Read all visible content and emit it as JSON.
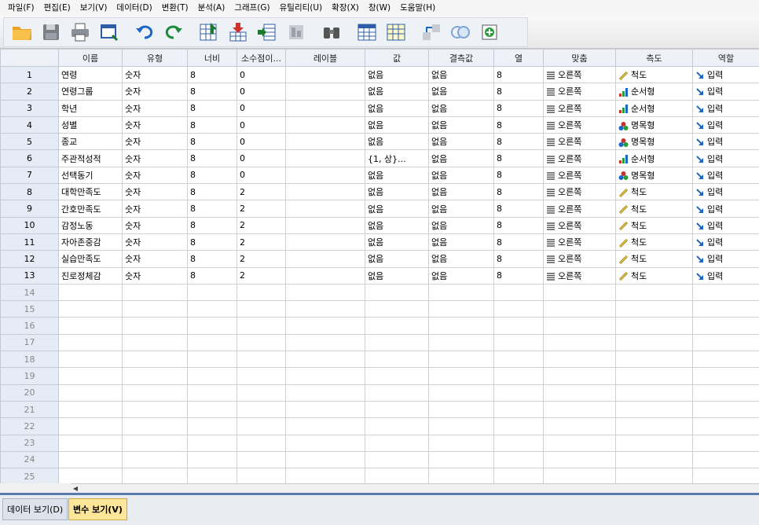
{
  "menu": [
    "파일(F)",
    "편집(E)",
    "보기(V)",
    "데이터(D)",
    "변환(T)",
    "분석(A)",
    "그래프(G)",
    "유틸리티(U)",
    "확장(X)",
    "창(W)",
    "도움말(H)"
  ],
  "toolbar": {
    "icons": [
      "open-folder-icon",
      "save-icon",
      "print-icon",
      "dialog-recall-icon",
      "undo-icon",
      "redo-icon",
      "goto-case-icon",
      "goto-variable-icon",
      "variables-icon",
      "run-descriptives-icon",
      "find-icon",
      "insert-cases-icon",
      "insert-variable-icon",
      "split-file-icon",
      "value-labels-icon",
      "use-variable-sets-icon"
    ]
  },
  "columns": [
    "",
    "이름",
    "유형",
    "너비",
    "소수점이...",
    "레이블",
    "값",
    "결측값",
    "열",
    "맞춤",
    "측도",
    "역할"
  ],
  "rows": [
    {
      "n": "1",
      "name": "연령",
      "type": "숫자",
      "width": "8",
      "dec": "0",
      "label": "",
      "values": "없음",
      "missing": "없음",
      "cols": "8",
      "align": "오른쪽",
      "measure": "척도",
      "measure_icon": "scale",
      "role": "입력"
    },
    {
      "n": "2",
      "name": "연령그룹",
      "type": "숫자",
      "width": "8",
      "dec": "0",
      "label": "",
      "values": "없음",
      "missing": "없음",
      "cols": "8",
      "align": "오른쪽",
      "measure": "순서형",
      "measure_icon": "ordinal",
      "role": "입력"
    },
    {
      "n": "3",
      "name": "학년",
      "type": "숫자",
      "width": "8",
      "dec": "0",
      "label": "",
      "values": "없음",
      "missing": "없음",
      "cols": "8",
      "align": "오른쪽",
      "measure": "순서형",
      "measure_icon": "ordinal",
      "role": "입력"
    },
    {
      "n": "4",
      "name": "성별",
      "type": "숫자",
      "width": "8",
      "dec": "0",
      "label": "",
      "values": "없음",
      "missing": "없음",
      "cols": "8",
      "align": "오른쪽",
      "measure": "명목형",
      "measure_icon": "nominal",
      "role": "입력"
    },
    {
      "n": "5",
      "name": "종교",
      "type": "숫자",
      "width": "8",
      "dec": "0",
      "label": "",
      "values": "없음",
      "missing": "없음",
      "cols": "8",
      "align": "오른쪽",
      "measure": "명목형",
      "measure_icon": "nominal",
      "role": "입력"
    },
    {
      "n": "6",
      "name": "주관적성적",
      "type": "숫자",
      "width": "8",
      "dec": "0",
      "label": "",
      "values": "{1, 상}...",
      "missing": "없음",
      "cols": "8",
      "align": "오른쪽",
      "measure": "순서형",
      "measure_icon": "ordinal",
      "role": "입력"
    },
    {
      "n": "7",
      "name": "선택동기",
      "type": "숫자",
      "width": "8",
      "dec": "0",
      "label": "",
      "values": "없음",
      "missing": "없음",
      "cols": "8",
      "align": "오른쪽",
      "measure": "명목형",
      "measure_icon": "nominal",
      "role": "입력"
    },
    {
      "n": "8",
      "name": "대학만족도",
      "type": "숫자",
      "width": "8",
      "dec": "2",
      "label": "",
      "values": "없음",
      "missing": "없음",
      "cols": "8",
      "align": "오른쪽",
      "measure": "척도",
      "measure_icon": "scale",
      "role": "입력"
    },
    {
      "n": "9",
      "name": "간호만족도",
      "type": "숫자",
      "width": "8",
      "dec": "2",
      "label": "",
      "values": "없음",
      "missing": "없음",
      "cols": "8",
      "align": "오른쪽",
      "measure": "척도",
      "measure_icon": "scale",
      "role": "입력"
    },
    {
      "n": "10",
      "name": "감정노동",
      "type": "숫자",
      "width": "8",
      "dec": "2",
      "label": "",
      "values": "없음",
      "missing": "없음",
      "cols": "8",
      "align": "오른쪽",
      "measure": "척도",
      "measure_icon": "scale",
      "role": "입력"
    },
    {
      "n": "11",
      "name": "자아존중감",
      "type": "숫자",
      "width": "8",
      "dec": "2",
      "label": "",
      "values": "없음",
      "missing": "없음",
      "cols": "8",
      "align": "오른쪽",
      "measure": "척도",
      "measure_icon": "scale",
      "role": "입력"
    },
    {
      "n": "12",
      "name": "실습만족도",
      "type": "숫자",
      "width": "8",
      "dec": "2",
      "label": "",
      "values": "없음",
      "missing": "없음",
      "cols": "8",
      "align": "오른쪽",
      "measure": "척도",
      "measure_icon": "scale",
      "role": "입력"
    },
    {
      "n": "13",
      "name": "진로정체감",
      "type": "숫자",
      "width": "8",
      "dec": "2",
      "label": "",
      "values": "없음",
      "missing": "없음",
      "cols": "8",
      "align": "오른쪽",
      "measure": "척도",
      "measure_icon": "scale",
      "role": "입력"
    }
  ],
  "empty_rows": [
    "14",
    "15",
    "16",
    "17",
    "18",
    "19",
    "20",
    "21",
    "22",
    "23",
    "24",
    "25"
  ],
  "tabs": {
    "data_view": "데이터 보기(D)",
    "variable_view": "변수 보기(V)"
  },
  "colors": {
    "accent": "#5a7bb0",
    "active_tab": "#fde59a",
    "header_bg": "#eef2f8"
  }
}
